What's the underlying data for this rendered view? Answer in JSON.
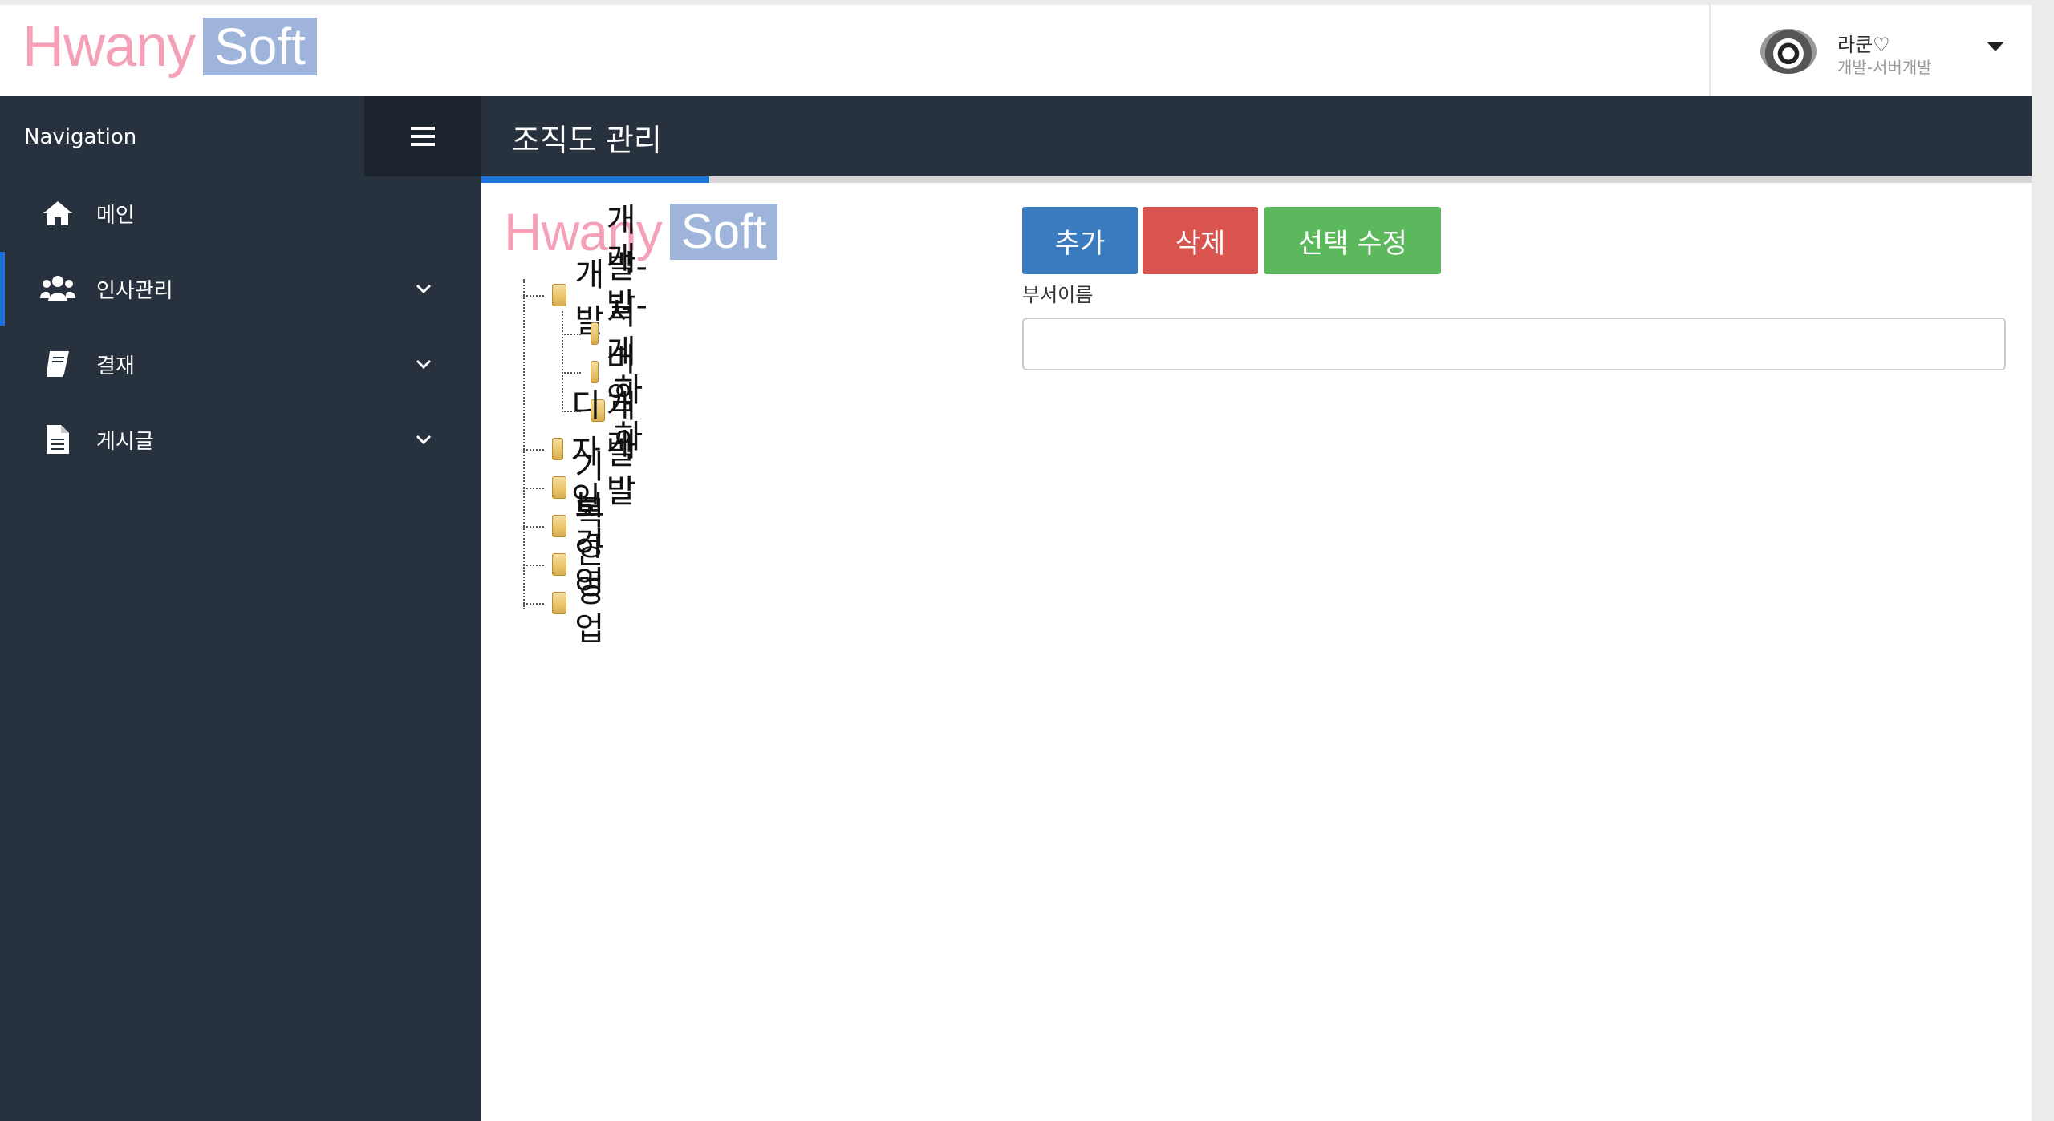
{
  "brand": {
    "hw": "Hwany",
    "soft": "Soft"
  },
  "user": {
    "name": "라쿤♡",
    "dept": "개발-서버개발"
  },
  "sidebar": {
    "title": "Navigation",
    "items": [
      {
        "label": "메인",
        "icon": "home-icon",
        "expandable": false
      },
      {
        "label": "인사관리",
        "icon": "users-icon",
        "expandable": true,
        "active": true
      },
      {
        "label": "결재",
        "icon": "book-icon",
        "expandable": true
      },
      {
        "label": "게시글",
        "icon": "document-icon",
        "expandable": true
      }
    ]
  },
  "header": {
    "title": "조직도 관리"
  },
  "tree": {
    "nodes": [
      {
        "label": "개발",
        "depth": 0,
        "expanded": true
      },
      {
        "label": "개발-서버개발",
        "depth": 1
      },
      {
        "label": "개발-게임개발",
        "depth": 1
      },
      {
        "label": "하하",
        "depth": 1
      },
      {
        "label": "디자인",
        "depth": 0
      },
      {
        "label": "기획",
        "depth": 0
      },
      {
        "label": "보안",
        "depth": 0
      },
      {
        "label": "경영",
        "depth": 0
      },
      {
        "label": "영업",
        "depth": 0
      }
    ]
  },
  "actions": {
    "add": "추가",
    "delete": "삭제",
    "edit": "선택 수정"
  },
  "form": {
    "label": "부서이름",
    "value": "",
    "placeholder": ""
  },
  "colors": {
    "sidebar": "#27323e",
    "accent": "#1d74d8",
    "add": "#3a7bbf",
    "delete": "#d9534f",
    "edit": "#5cb85c"
  }
}
